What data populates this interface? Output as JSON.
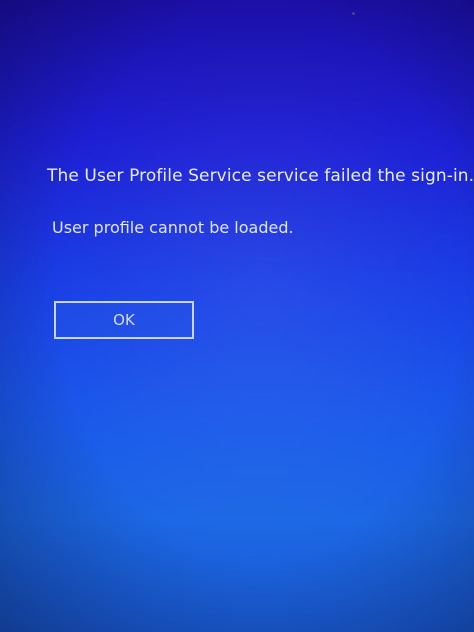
{
  "dialog": {
    "title": "The User Profile Service service failed the sign-in.",
    "message": "User profile cannot be loaded.",
    "ok_label": "OK"
  },
  "colors": {
    "background_top": "#1c0fa8",
    "background_bottom": "#1a5ad2",
    "text": "#e8ecff",
    "button_border": "#c9d3ff"
  }
}
